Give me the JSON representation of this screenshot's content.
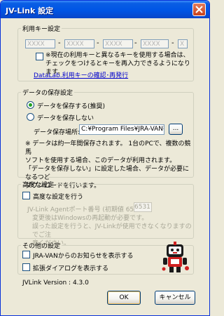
{
  "window": {
    "title": "JV-Link 設定"
  },
  "key_group": {
    "legend": "利用キー設定",
    "fields": [
      "XXXX",
      "XXXX",
      "XXXX",
      "XXXX",
      "X"
    ],
    "separator": "-",
    "checkbox_label_line1": "※現在の利用キーと異なるキーを使用する場合は、",
    "checkbox_label_line2": "チェックをつけるとキーを再入力できるようになります。",
    "link": "DataLab.利用キーの確認･再発行"
  },
  "storage_group": {
    "legend": "データの保存設定",
    "radio_save": "データを保存する(推奨)",
    "radio_nosave": "データを保存しない",
    "path_label": "データ保存場所:",
    "path_value": "C:¥Program Files¥JRA-VAN¥D",
    "browse_label": "...",
    "note_line1": "※ データは約一年間保存されます。 1台のPCで、複数の競馬",
    "note_line2": "ソフトを使用する場合、このデータが利用されます。",
    "note_line3": "「データを保存しない」に設定した場合、データが必要になるつど",
    "note_line4": "ダウンロードを行います。"
  },
  "advanced_group": {
    "legend": "高度な設定",
    "checkbox_label": "高度な設定を行う",
    "port_label": "JV-Link Agentポート番号 (初期値 6531):",
    "port_value": "6531",
    "note_line1": "変更後はWindowsの再起動が必要です。",
    "note_line2": "誤った設定を行うと、JV-Linkが使用できなくなりますのでご注",
    "note_line3": "意ください。"
  },
  "other_group": {
    "legend": "その他の設定",
    "checkbox_notice": "JRA-VANからのお知らせを表示する",
    "checkbox_dialog": "拡張ダイアログを表示する"
  },
  "footer": {
    "version": "JVLink Version : 4.3.0",
    "ok_label": "OK",
    "cancel_label": "キャンセル"
  }
}
